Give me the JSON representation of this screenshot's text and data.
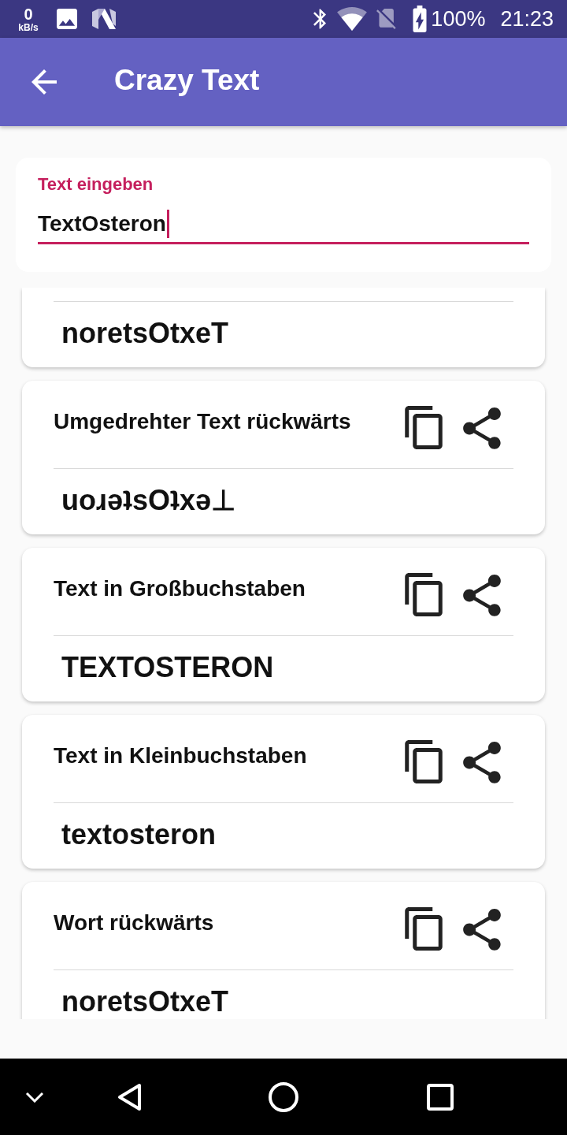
{
  "status_bar": {
    "speed_value": "0",
    "speed_unit": "kB/s",
    "battery": "100%",
    "time": "21:23"
  },
  "app_bar": {
    "title": "Crazy Text"
  },
  "input": {
    "label": "Text eingeben",
    "value": "TextOsteron",
    "focused": true
  },
  "results": [
    {
      "result": "noretsOtxeT"
    },
    {
      "title": "Umgedrehter Text rückwärts",
      "result": "uoɹǝʇsOʇxǝ⊥"
    },
    {
      "title": "Text in Großbuchstaben",
      "result": "TEXTOSTERON"
    },
    {
      "title": "Text in Kleinbuchstaben",
      "result": "textosteron"
    },
    {
      "title": "Wort rückwärts",
      "result": "noretsOtxeT"
    }
  ]
}
